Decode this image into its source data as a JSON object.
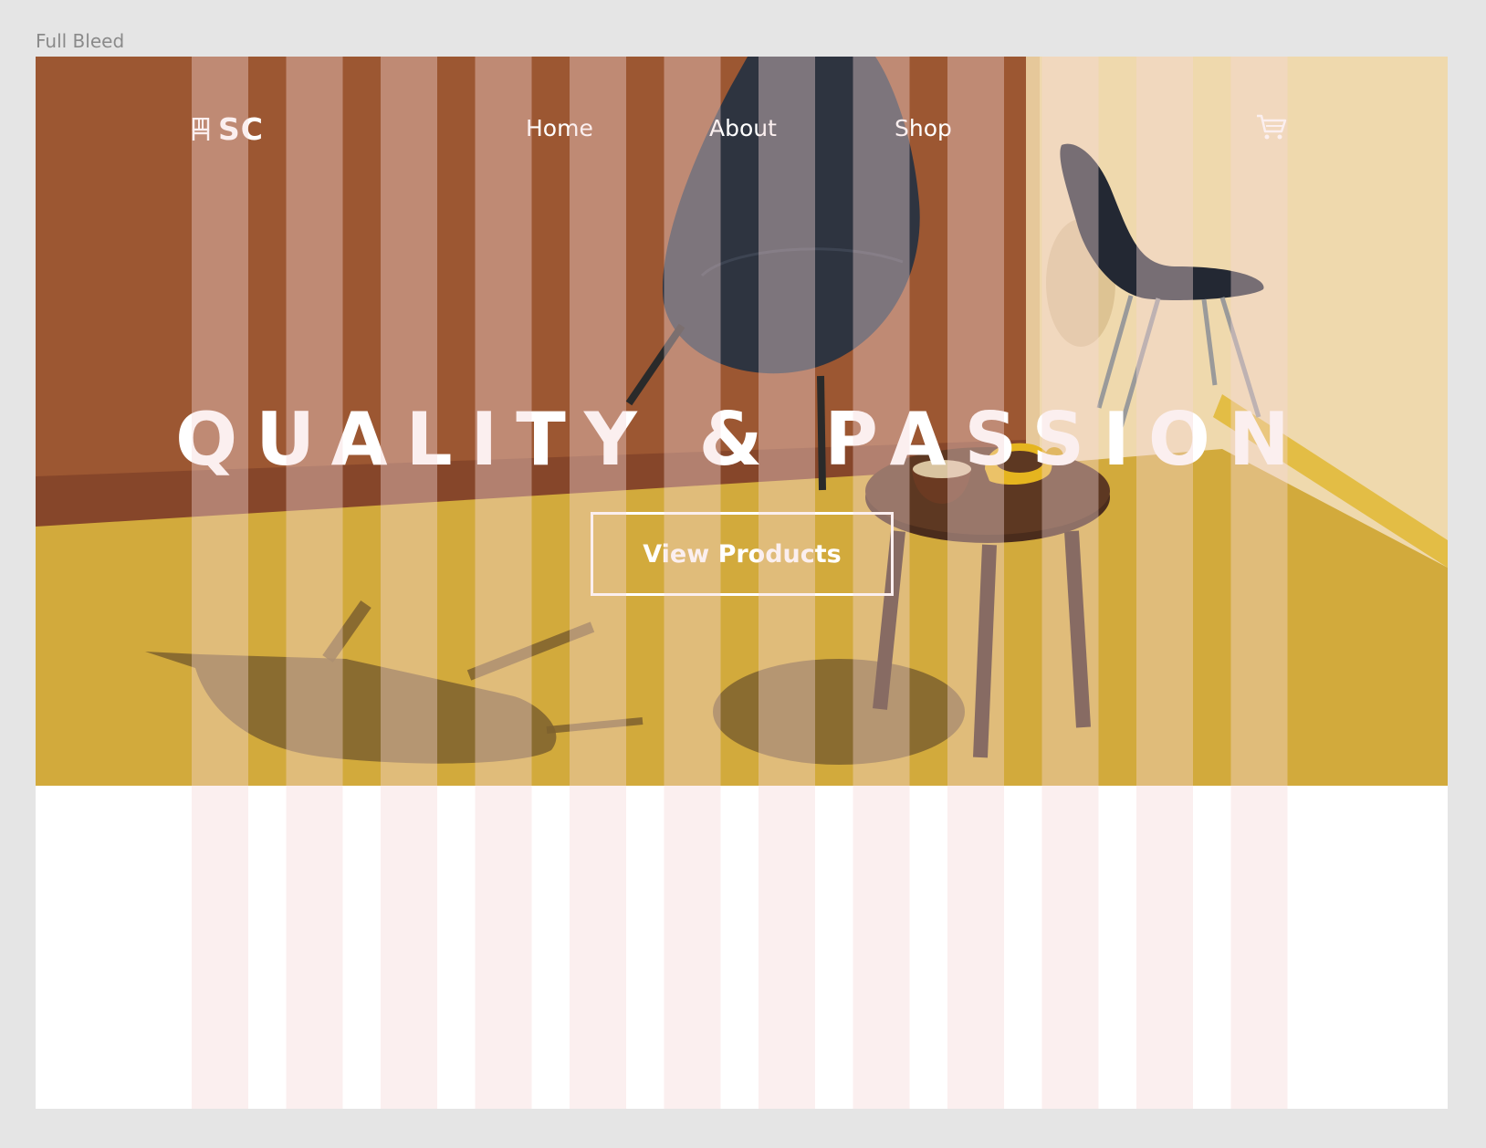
{
  "frame": {
    "label": "Full Bleed"
  },
  "nav": {
    "logo_text": "SC",
    "logo_icon": "chair-icon",
    "links": [
      "Home",
      "About",
      "Shop"
    ],
    "cart_icon": "cart-icon"
  },
  "hero": {
    "headline": "QUALITY & PASSION",
    "cta_label": "View Products"
  },
  "colors": {
    "canvas": "#e5e5e5",
    "wall": "#9b5530",
    "floor": "#d4ac3e",
    "grid_column": "#f6d8d8"
  }
}
